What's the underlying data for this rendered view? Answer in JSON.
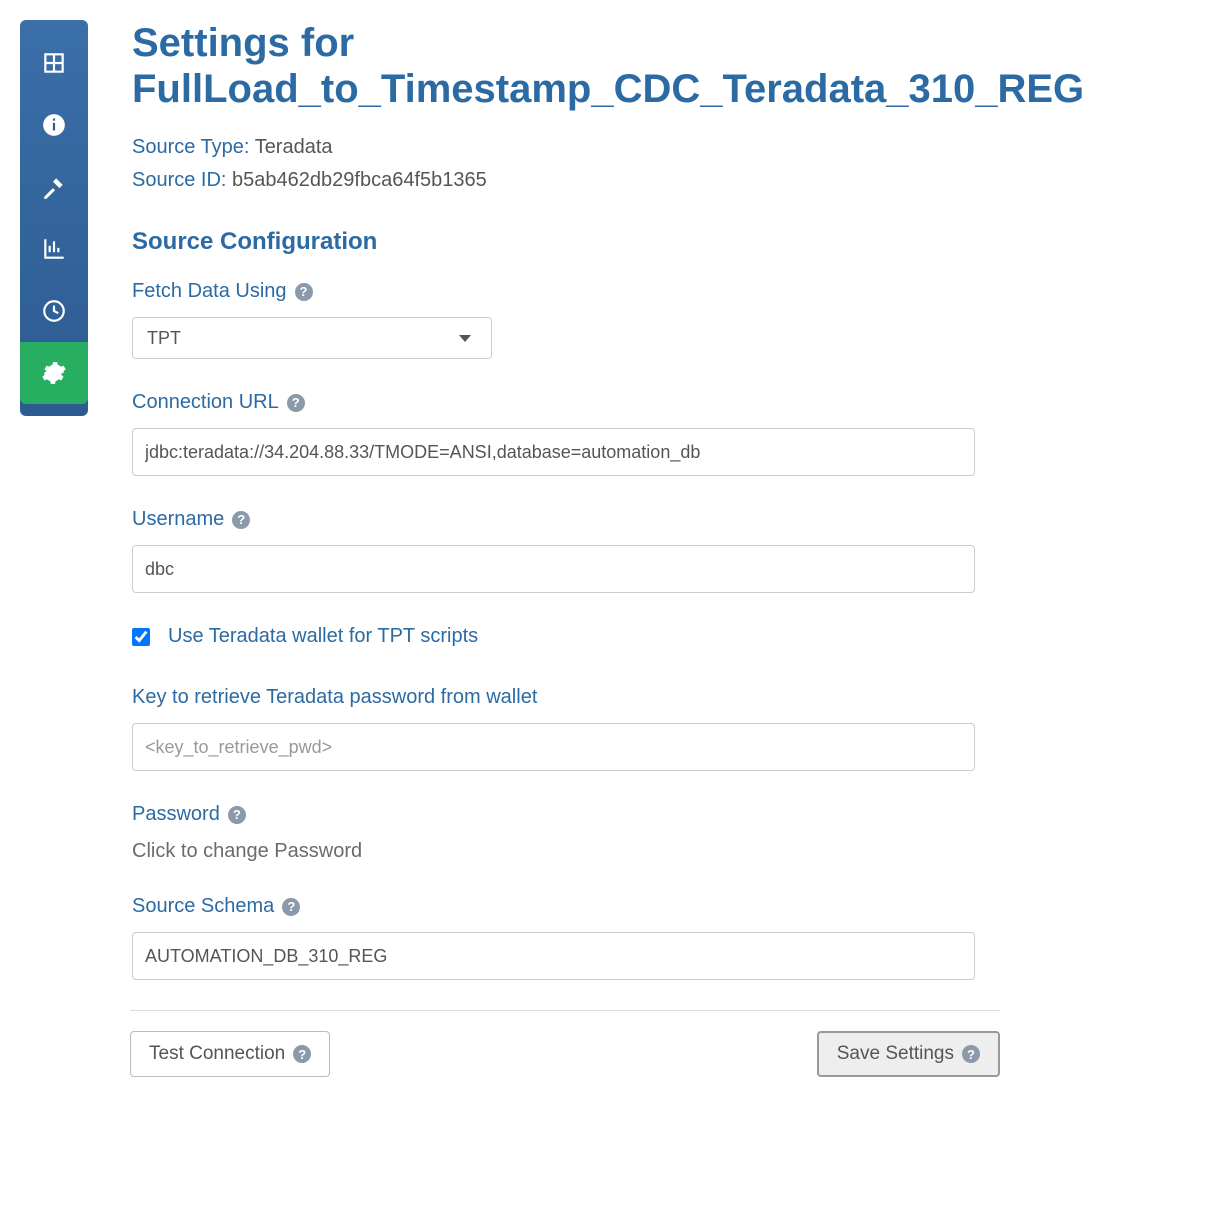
{
  "page_title": "Settings for FullLoad_to_Timestamp_CDC_Teradata_310_REG",
  "meta": {
    "source_type_label": "Source Type:",
    "source_type_value": "Teradata",
    "source_id_label": "Source ID:",
    "source_id_value": "b5ab462db29fbca64f5b1365"
  },
  "section_header": "Source Configuration",
  "fields": {
    "fetch_data_using": {
      "label": "Fetch Data Using",
      "value": "TPT"
    },
    "connection_url": {
      "label": "Connection URL",
      "value": "jdbc:teradata://34.204.88.33/TMODE=ANSI,database=automation_db"
    },
    "username": {
      "label": "Username",
      "value": "dbc"
    },
    "use_wallet": {
      "label": "Use Teradata wallet for TPT scripts",
      "checked": true
    },
    "wallet_key": {
      "label": "Key to retrieve Teradata password from wallet",
      "placeholder": "<key_to_retrieve_pwd>"
    },
    "password": {
      "label": "Password",
      "hint": "Click to change Password"
    },
    "source_schema": {
      "label": "Source Schema",
      "value": "AUTOMATION_DB_310_REG"
    }
  },
  "buttons": {
    "test_connection": "Test Connection",
    "save_settings": "Save Settings"
  },
  "help_icon_text": "?"
}
